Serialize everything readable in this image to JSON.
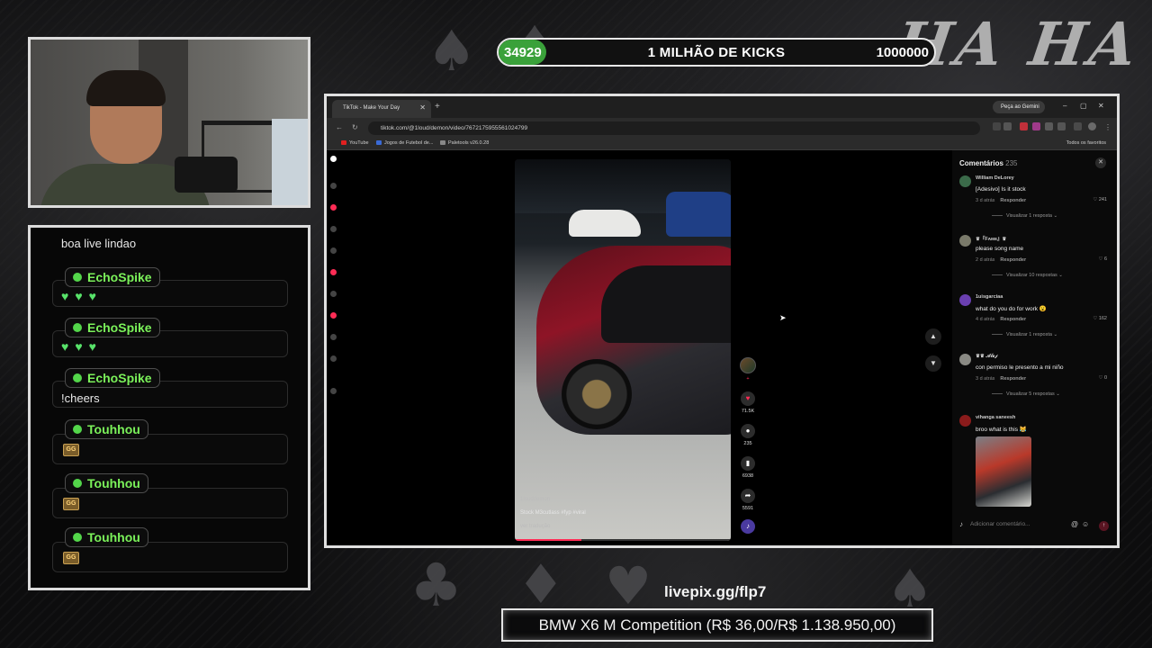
{
  "overlay": {
    "goal": {
      "current": "34929",
      "title": "1 MILHÃO DE KICKS",
      "target": "1000000",
      "progress": 0.035
    },
    "brand_text": "HA HA",
    "livepix": "livepix.gg/flp7",
    "prize": "BMW X6 M Competition (R$ 36,00/R$ 1.138.950,00)"
  },
  "chat": {
    "top_message": "boa live lindao",
    "messages": [
      {
        "user": "EchoSpike",
        "content": "hearts",
        "hearts": "♥♥♥"
      },
      {
        "user": "EchoSpike",
        "content": "hearts",
        "hearts": "♥♥♥"
      },
      {
        "user": "EchoSpike",
        "content": "text",
        "text": "!cheers"
      },
      {
        "user": "Touhhou",
        "content": "emote",
        "emote": "GG"
      },
      {
        "user": "Touhhou",
        "content": "emote",
        "emote": "GG"
      },
      {
        "user": "Touhhou",
        "content": "emote",
        "emote": "GG"
      }
    ]
  },
  "browser": {
    "tab_title": "TikTok - Make Your Day",
    "gemini_button": "Peça ao Gemini",
    "url": "tiktok.com/@1loud/demon/video/7672175955561024799",
    "bookmarks": [
      "YouTube",
      "Jogos de Futebol de...",
      "Paletools v26.0.28"
    ],
    "bookmarks_right": "Todos os favoritos"
  },
  "video": {
    "username": "1louddemon",
    "caption": "Stock M3cutlass #fyp #viral",
    "translate": "ver tradução",
    "progress": 0.31,
    "actions": {
      "likes": "71.5K",
      "comments": "235",
      "saves": "6938",
      "shares": "5591"
    }
  },
  "comments": {
    "title": "Comentários",
    "count": "235",
    "reply_label": "Responder",
    "input_placeholder": "Adicionar comentário...",
    "items": [
      {
        "user": "William DeLorey",
        "text": "[Adesivo] Is it stock",
        "time": "3 d atrás",
        "likes": "241",
        "more": "Visualizar 1 resposta",
        "avatar_color": "#3b6b4a"
      },
      {
        "user": "♛『Fᴀᴍᴇ』♛",
        "text": "please song name",
        "time": "2 d atrás",
        "likes": "6",
        "more": "Visualizar 10 respostas",
        "avatar_color": "#7a7a6a"
      },
      {
        "user": "1uisgarciaa",
        "text": "what do you do for work 😮",
        "time": "4 d atrás",
        "likes": "162",
        "more": "Visualizar 1 resposta",
        "avatar_color": "#6a3fb0"
      },
      {
        "user": "♛♛ 𝓐𝓵𝓮𝓳",
        "text": "con permiso le presento a mi niño",
        "time": "3 d atrás",
        "likes": "0",
        "more": "Visualizar 5 respostas",
        "avatar_color": "#8a8a84"
      },
      {
        "user": "vihanga saneesh",
        "text": "broo what is this 😹",
        "time": "",
        "likes": "",
        "more": "",
        "avatar_color": "#8a1b1b"
      }
    ]
  }
}
